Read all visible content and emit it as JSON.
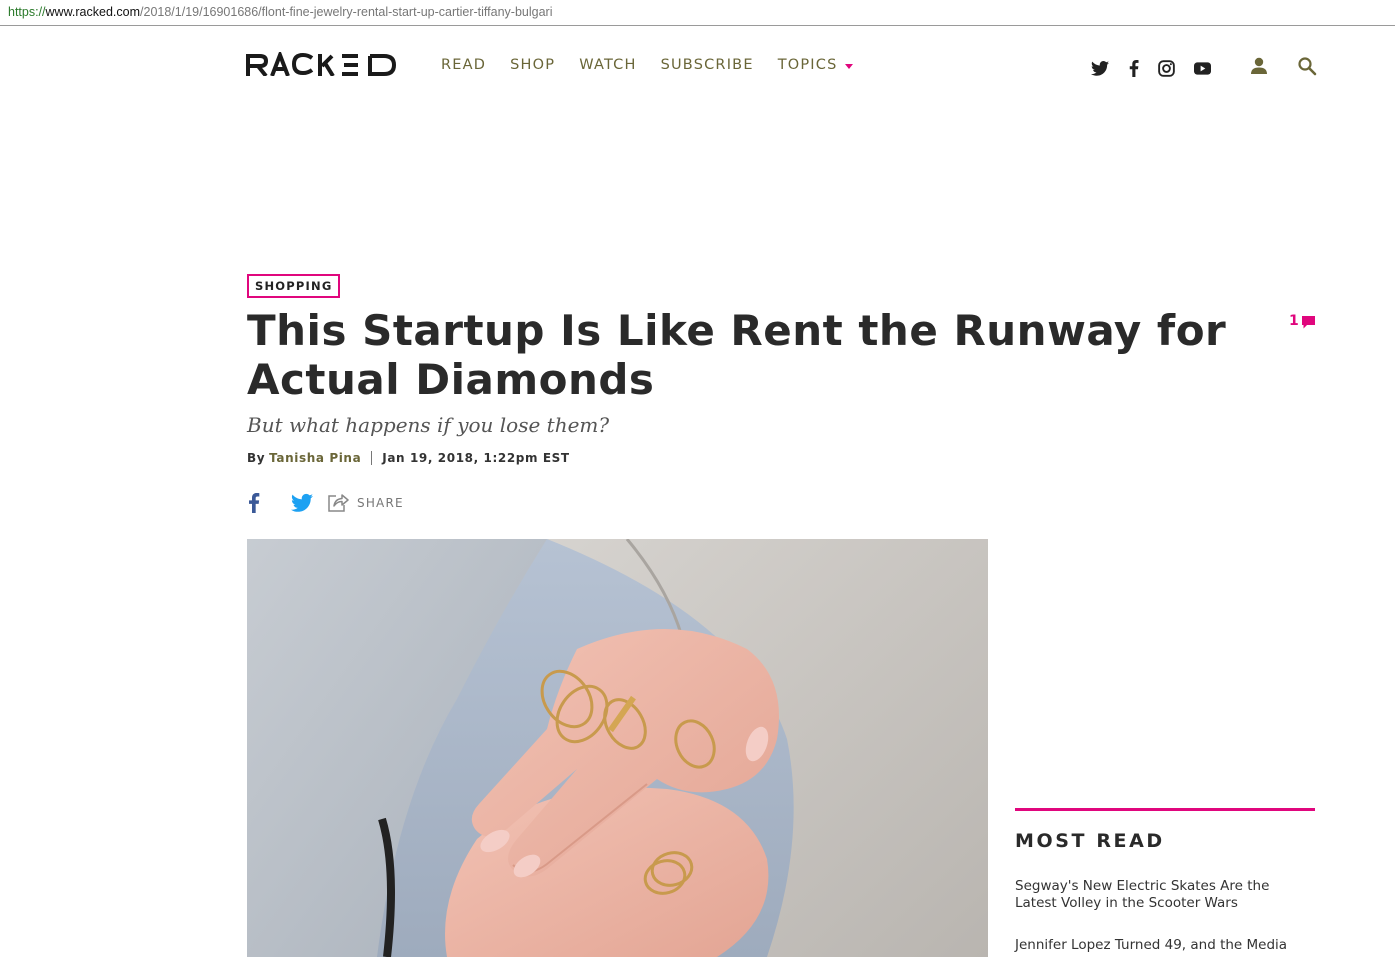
{
  "browser": {
    "url_scheme": "https://",
    "url_host": "www.racked.com",
    "url_path": "/2018/1/19/16901686/flont-fine-jewelry-rental-start-up-cartier-tiffany-bulgari"
  },
  "header": {
    "logo": "RACKED",
    "nav": {
      "read": "READ",
      "shop": "SHOP",
      "watch": "WATCH",
      "subscribe": "SUBSCRIBE",
      "topics": "TOPICS"
    },
    "social_icons": [
      "twitter-icon",
      "facebook-icon",
      "instagram-icon",
      "youtube-icon"
    ],
    "accent_color": "#e0067d",
    "nav_color": "#6a6638"
  },
  "article": {
    "tag": "SHOPPING",
    "comment_count": "1",
    "headline": "This Startup Is Like Rent the Runway for Actual Diamonds",
    "dek": "But what happens if you lose them?",
    "byline_prefix": "By",
    "author": "Tanisha Pina",
    "date": "Jan 19, 2018, 1:22pm EST",
    "share_label": "SHARE"
  },
  "sidebar": {
    "most_read_title": "MOST READ",
    "items": [
      "Segway's New Electric Skates Are the Latest Volley in the Scooter Wars",
      "Jennifer Lopez Turned 49, and the Media"
    ]
  }
}
